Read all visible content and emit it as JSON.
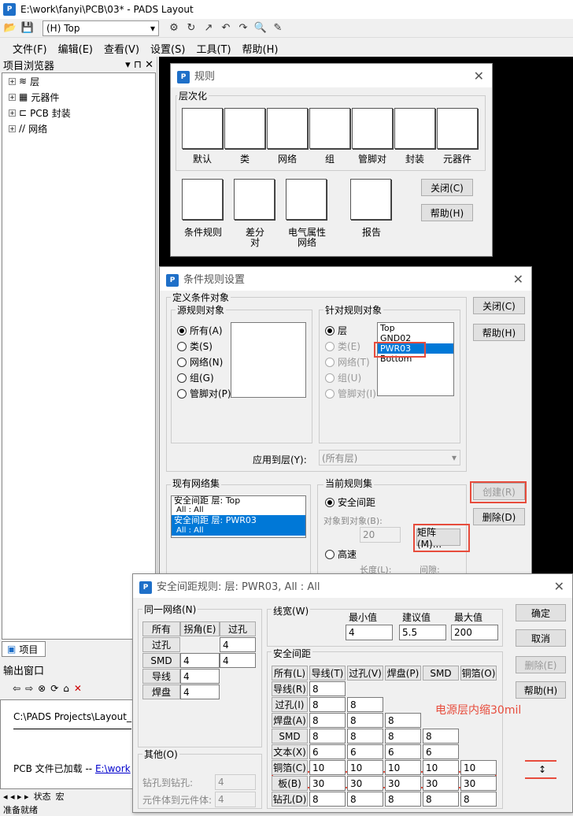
{
  "window": {
    "title": "E:\\work\\fanyi\\PCB\\03* - PADS Layout",
    "layer_combo": "(H) Top"
  },
  "menu": [
    "文件(F)",
    "编辑(E)",
    "查看(V)",
    "设置(S)",
    "工具(T)",
    "帮助(H)"
  ],
  "project": {
    "title": "项目浏览器",
    "items": [
      "层",
      "元器件",
      "PCB 封装",
      "网络"
    ],
    "tab": "项目"
  },
  "output": {
    "title": "输出窗口",
    "line1": "C:\\PADS Projects\\Layout_",
    "line2": "PCB 文件已加载  -- ",
    "link": "E:\\work",
    "tabs": [
      "状态",
      "宏"
    ],
    "status": "准备就绪"
  },
  "rules": {
    "title": "规则",
    "group": "层次化",
    "icons": [
      "默认",
      "类",
      "网络",
      "组",
      "管脚对",
      "封装",
      "元器件"
    ],
    "icons2": [
      "条件规则",
      "差分\n对",
      "电气属性\n网络",
      "报告"
    ],
    "close": "关闭(C)",
    "help": "帮助(H)"
  },
  "cond": {
    "title": "条件规则设置",
    "define": "定义条件对象",
    "source": "源规则对象",
    "src_opts": [
      "所有(A)",
      "类(S)",
      "网络(N)",
      "组(G)",
      "管脚对(P)"
    ],
    "target": "针对规则对象",
    "tgt_opts": [
      "层",
      "类(E)",
      "网络(T)",
      "组(U)",
      "管脚对(I)"
    ],
    "layers": [
      "Top",
      "GND02",
      "PWR03",
      "Bottom"
    ],
    "apply_label": "应用到层(Y):",
    "apply_value": "(所有层)",
    "existing": "现有网络集",
    "existing_items": [
      [
        "安全间距  层: Top",
        "All  :  All"
      ],
      [
        "安全间距  层: PWR03",
        "All  :  All"
      ]
    ],
    "current": "当前规则集",
    "cur_clear": "安全间距",
    "obj_to_obj": "对象到对象(B):",
    "obj_val": "20",
    "matrix": "矩阵(M)...",
    "hispeed": "高速",
    "length": "长度(L):",
    "spacing": "间隙:",
    "close": "关闭(C)",
    "help": "帮助(H)",
    "create": "创建(R)",
    "delete": "删除(D)"
  },
  "clear": {
    "title": "安全间距规则: 层: PWR03,  All  :  All",
    "same_net": "同一网络(N)",
    "sn_headers": [
      "所有",
      "拐角(E)",
      "过孔"
    ],
    "sn_rows": [
      [
        "过孔",
        "",
        "4"
      ],
      [
        "SMD",
        "4",
        "4"
      ],
      [
        "导线",
        "4"
      ],
      [
        "焊盘",
        "4"
      ]
    ],
    "trace_width": "线宽(W)",
    "tw_headers": [
      "最小值",
      "建议值",
      "最大值"
    ],
    "tw_values": [
      "4",
      "5.5",
      "200"
    ],
    "clearance": "安全间距",
    "cl_headers": [
      "所有(L)",
      "导线(T)",
      "过孔(V)",
      "焊盘(P)",
      "SMD",
      "铜箔(O)"
    ],
    "cl_rows": [
      {
        "h": "导线(R)",
        "v": [
          "8"
        ]
      },
      {
        "h": "过孔(I)",
        "v": [
          "8",
          "8"
        ]
      },
      {
        "h": "焊盘(A)",
        "v": [
          "8",
          "8",
          "8"
        ]
      },
      {
        "h": "SMD",
        "v": [
          "8",
          "8",
          "8",
          "8"
        ]
      },
      {
        "h": "文本(X)",
        "v": [
          "6",
          "6",
          "6",
          "6"
        ]
      },
      {
        "h": "铜箔(C)",
        "v": [
          "10",
          "10",
          "10",
          "10",
          "10"
        ]
      },
      {
        "h": "板(B)",
        "v": [
          "30",
          "30",
          "30",
          "30",
          "30"
        ]
      },
      {
        "h": "钻孔(D)",
        "v": [
          "8",
          "8",
          "8",
          "8",
          "8"
        ]
      }
    ],
    "other": "其他(O)",
    "drill": "钻孔到钻孔:",
    "drill_val": "4",
    "body": "元件体到元件体:",
    "body_val": "4",
    "ok": "确定",
    "cancel": "取消",
    "delete": "删除(E)",
    "help": "帮助(H)",
    "note": "电源层内缩30mil"
  },
  "colors": {
    "accent": "#0078d7",
    "red": "#e74c3c"
  }
}
